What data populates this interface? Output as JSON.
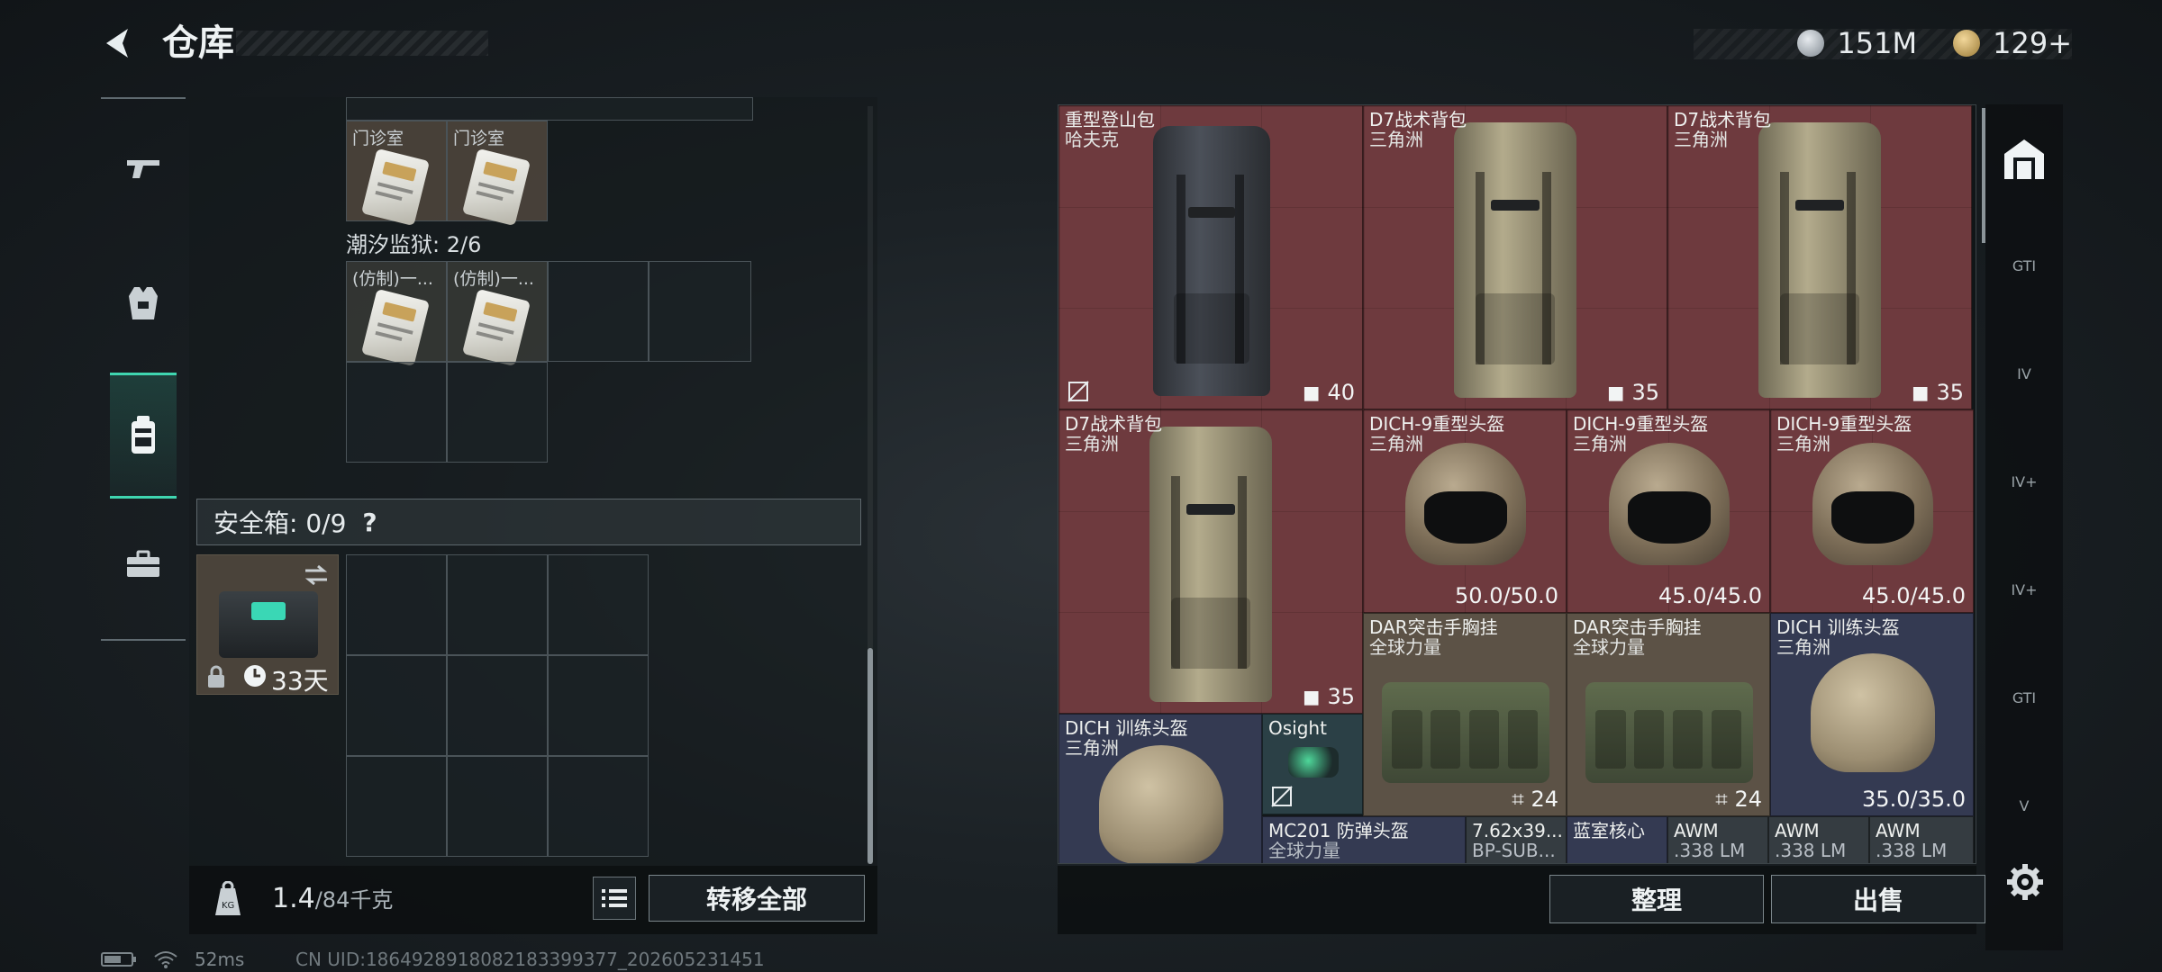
{
  "header": {
    "title": "仓库",
    "currency": [
      {
        "icon": "silver-coin-icon",
        "value": "151M"
      },
      {
        "icon": "gold-coin-icon",
        "value": "129+"
      }
    ]
  },
  "left_nav": [
    {
      "name": "weapons",
      "icon": "pistol-icon",
      "active": false
    },
    {
      "name": "armor",
      "icon": "vest-icon",
      "active": false
    },
    {
      "name": "backpack",
      "icon": "backpack-icon",
      "active": true
    },
    {
      "name": "toolbox",
      "icon": "toolbox-icon",
      "active": false
    }
  ],
  "left_panel": {
    "clinic_items": [
      "门诊室",
      "门诊室"
    ],
    "prison_section": {
      "label": "潮汐监狱: 2/6",
      "items": [
        "(仿制)一...",
        "(仿制)一..."
      ]
    },
    "safebox": {
      "label": "安全箱: 0/9",
      "help": "?",
      "days": "33天"
    },
    "weight": {
      "current": "1.4",
      "max": "/84千克"
    },
    "transfer_all": "转移全部"
  },
  "status": {
    "ping": "52ms",
    "uid": "CN UID:1864928918082183399377_202605231451"
  },
  "stash_items": [
    {
      "name": "重型登山包",
      "sub": "哈夫克",
      "val": "40"
    },
    {
      "name": "D7战术背包",
      "sub": "三角洲",
      "val": "35"
    },
    {
      "name": "D7战术背包",
      "sub": "三角洲",
      "val": "35"
    },
    {
      "name": "D7战术背包",
      "sub": "三角洲",
      "val": "35"
    },
    {
      "name": "DICH-9重型头盔",
      "sub": "三角洲",
      "val": "50.0/50.0"
    },
    {
      "name": "DICH-9重型头盔",
      "sub": "三角洲",
      "val": "45.0/45.0"
    },
    {
      "name": "DICH-9重型头盔",
      "sub": "三角洲",
      "val": "45.0/45.0"
    },
    {
      "name": "DAR突击手胸挂",
      "sub": "全球力量",
      "val": "24"
    },
    {
      "name": "DAR突击手胸挂",
      "sub": "全球力量",
      "val": "24"
    },
    {
      "name": "DICH 训练头盔",
      "sub": "三角洲",
      "val": "35.0/35.0"
    },
    {
      "name": "DICH 训练头盔",
      "sub": "三角洲",
      "val": ""
    },
    {
      "name": "Osight",
      "sub": "",
      "val": ""
    },
    {
      "name": "MC201 防弹头盔",
      "sub": "全球力量",
      "val": ""
    },
    {
      "name": "7.62x39...",
      "sub": "BP-SUB...",
      "val": ""
    },
    {
      "name": "蓝室核心",
      "sub": "",
      "val": ""
    },
    {
      "name": "AWM",
      "sub": ".338 LM",
      "val": ""
    },
    {
      "name": "AWM",
      "sub": ".338 LM",
      "val": ""
    },
    {
      "name": "AWM",
      "sub": ".338 LM",
      "val": ""
    }
  ],
  "right_actions": {
    "sort": "整理",
    "sell": "出售"
  },
  "side_tabs": [
    "GTI",
    "IV",
    "IV+",
    "IV+",
    "GTI",
    "V"
  ]
}
